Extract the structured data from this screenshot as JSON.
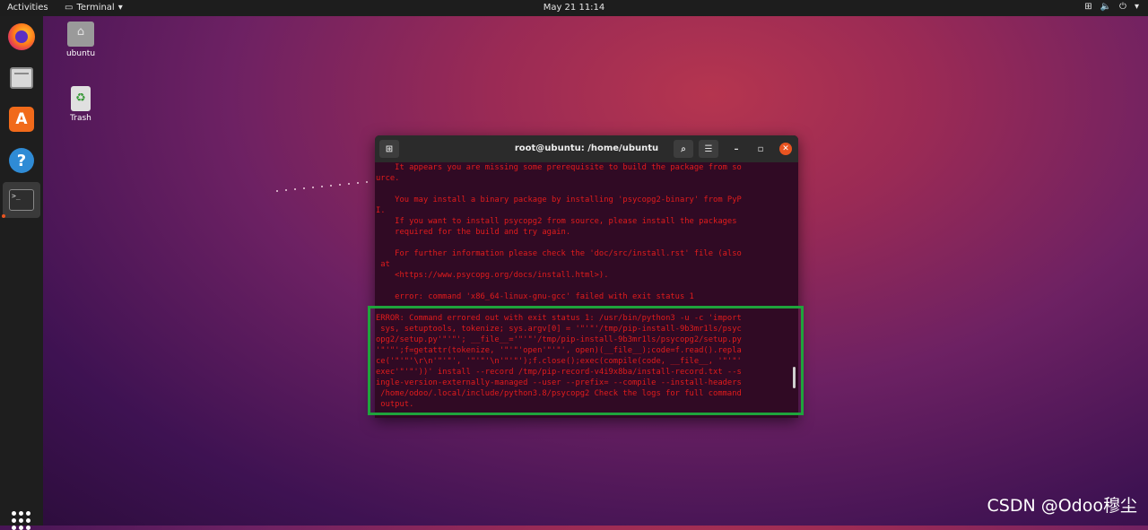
{
  "topbar": {
    "activities": "Activities",
    "app_name": "Terminal",
    "clock": "May 21  11:14",
    "tray_icons": [
      "network-icon",
      "volume-icon",
      "power-icon",
      "menu-arrow-icon"
    ]
  },
  "dock": {
    "items": [
      "firefox",
      "files",
      "ubuntu-software",
      "help",
      "terminal"
    ],
    "show_apps_icon": "app-grid-icon"
  },
  "desktop": {
    "icons": [
      {
        "label": "ubuntu",
        "icon": "home-folder-icon"
      },
      {
        "label": "Trash",
        "icon": "trash-icon"
      }
    ]
  },
  "terminal": {
    "title": "root@ubuntu: /home/ubuntu",
    "output_lines": [
      "    It appears you are missing some prerequisite to build the package from so",
      "urce.",
      "",
      "    You may install a binary package by installing 'psycopg2-binary' from PyP",
      "I.",
      "    If you want to install psycopg2 from source, please install the packages",
      "    required for the build and try again.",
      "",
      "    For further information please check the 'doc/src/install.rst' file (also",
      " at",
      "    <https://www.psycopg.org/docs/install.html>).",
      "",
      "    error: command 'x86_64-linux-gnu-gcc' failed with exit status 1",
      "    ----------------------------------------",
      "ERROR: Command errored out with exit status 1: /usr/bin/python3 -u -c 'import",
      " sys, setuptools, tokenize; sys.argv[0] = '\"'\"'/tmp/pip-install-9b3mr1ls/psyc",
      "opg2/setup.py'\"'\"'; __file__='\"'\"'/tmp/pip-install-9b3mr1ls/psycopg2/setup.py",
      "'\"'\"';f=getattr(tokenize, '\"'\"'open'\"'\"', open)(__file__);code=f.read().repla",
      "ce('\"'\"'\\r\\n'\"'\"', '\"'\"'\\n'\"'\"');f.close();exec(compile(code, __file__, '\"'\"'",
      "exec'\"'\"'))' install --record /tmp/pip-record-v4i9x8ba/install-record.txt --s",
      "ingle-version-externally-managed --user --prefix= --compile --install-headers",
      " /home/odoo/.local/include/python3.8/psycopg2 Check the logs for full command",
      " output."
    ]
  },
  "watermark": "CSDN @Odoo穆尘",
  "colors": {
    "terminal_bg": "#300a24",
    "error_text": "#e21c1c",
    "highlight_box": "#1fa33c",
    "close_button": "#e95420"
  }
}
